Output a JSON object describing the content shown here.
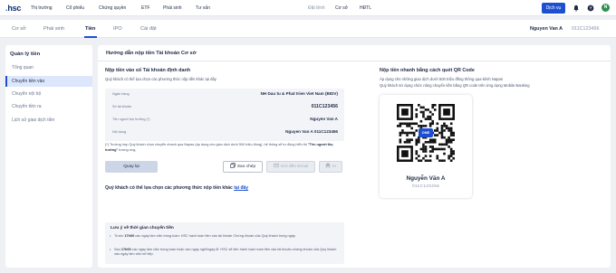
{
  "logo": {
    "mark": ".",
    "text": "hsc"
  },
  "topnav": {
    "items": [
      "Thị trường",
      "Cổ phiếu",
      "Chứng quyền",
      "ETF",
      "Phái sinh",
      "Tư vấn"
    ],
    "right": [
      "Đặt lệnh",
      "Cơ sở",
      "HĐTL"
    ],
    "service_button": "Dịch vụ",
    "avatar_letter": "N"
  },
  "subnav": {
    "tabs": [
      "Cơ sở",
      "Phái sinh",
      "Tiền",
      "IPO",
      "Cài đặt"
    ],
    "account_name": "Nguyen Van A",
    "account_number": "011C123456"
  },
  "sidebar": {
    "title": "Quản lý tiền",
    "items": [
      "Tổng quan",
      "Chuyển tiền vào",
      "Chuyển nội bộ",
      "Chuyển tiền ra",
      "Lịch sử giao dịch tiền"
    ]
  },
  "main": {
    "title": "Hướng dẫn nộp tiền Tài khoản Cơ sở",
    "left": {
      "title": "Nộp tiền vào số Tài khoản định danh",
      "subtitle": "Quý khách có thể lựa chọn các phương thức nộp tiền khác tại đây",
      "rows": [
        {
          "label": "Ngân hàng",
          "value": "NH Dau tu & Phat trien Viet Nam (BIDV)"
        },
        {
          "label": "Số tài khoản",
          "value": "011C123456"
        },
        {
          "label": "Tên người thụ hưởng (*)",
          "value": "Nguyen Van A"
        },
        {
          "label": "Nội dung",
          "value": "Nguyen Van A 011C123456"
        }
      ],
      "note_prefix": "(*) Trường hợp Quý khách chọn chuyển nhanh qua Napas (áp dụng cho giao dịch dưới 500 triệu đồng), hệ thống sẽ tự động hiển thị",
      "note_bold": "\"Tên người thụ hưởng\"",
      "note_suffix": "tương ứng.",
      "buttons": {
        "back": "Quay lại",
        "copy": "Sao chép",
        "email": "Gửi đến Email",
        "print": "In"
      },
      "other_method_text": "Quý khách có thể lựa chọn các phương thức nộp tiền khác",
      "other_method_link": "tại đây",
      "time_box": {
        "title": "Lưu ý về thời gian chuyển tiền",
        "items": [
          {
            "prefix": "Trước",
            "time": "17h00",
            "text": "các ngày làm việc trong tuần: HSC hạch toán tiền vào tài khoản Chứng khoán của Quý khách trong ngày."
          },
          {
            "prefix": "Sau",
            "time": "17h00",
            "text": "các ngày làm việc trong tuần hoặc vào ngày nghỉ/ngày lễ: HSC sẽ tiến hành hạch toán tiền vào tài khoản chứng khoán của Quý khách vào ngày làm việc kế tiếp."
          }
        ]
      }
    },
    "right": {
      "title": "Nộp tiền nhanh bằng cách quét QR Code",
      "line1": "Áp dụng cho những giao dịch dưới 500 triệu đồng thông qua kênh Napas",
      "line2": "Quý khách sử dụng chức năng chuyển tiền bằng QR code trên ứng dụng Mobile Banking",
      "qr_badge": "ONE",
      "qr_name": "Nguyễn Văn A",
      "qr_account": "011C123456"
    }
  },
  "colors": {
    "accent": "#1f4fd1",
    "navy": "#1f2a44",
    "muted": "#8a93a6",
    "panel": "#f2f4f8"
  }
}
